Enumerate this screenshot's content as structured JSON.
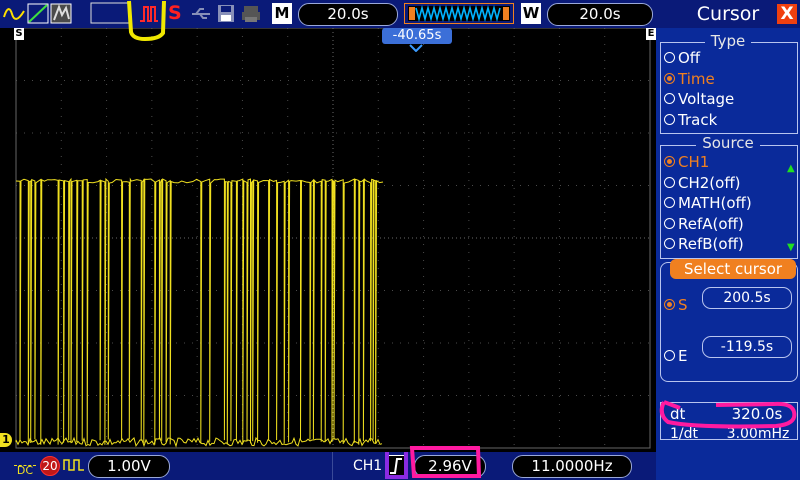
{
  "topbar": {
    "mode_glyph": "M",
    "timebase": "20.0s",
    "window_glyph": "W",
    "window_timebase": "20.0s",
    "stop_glyph": "S"
  },
  "screen": {
    "trigger_time_readout": "-40.65s",
    "left_marker": "S",
    "right_marker": "E",
    "ch1_marker": "1"
  },
  "panel": {
    "title": "Cursor",
    "close_glyph": "X",
    "type": {
      "title": "Type",
      "options": [
        {
          "label": "Off",
          "selected": false
        },
        {
          "label": "Time",
          "selected": true
        },
        {
          "label": "Voltage",
          "selected": false
        },
        {
          "label": "Track",
          "selected": false
        }
      ]
    },
    "source": {
      "title": "Source",
      "options": [
        {
          "label": "CH1",
          "selected": true
        },
        {
          "label": "CH2(off)",
          "selected": false
        },
        {
          "label": "MATH(off)",
          "selected": false
        },
        {
          "label": "RefA(off)",
          "selected": false
        },
        {
          "label": "RefB(off)",
          "selected": false
        }
      ],
      "scroll_up": "▲",
      "scroll_down": "▼"
    },
    "select": {
      "title": "Select cursor",
      "s_label": "S",
      "s_value": "200.5s",
      "e_label": "E",
      "e_value": "-119.5s"
    },
    "dt_label": "dt",
    "dt_value": "320.0s",
    "inv_dt_label": "1/dt",
    "inv_dt_value": "3.00mHz"
  },
  "bottombar": {
    "coupling": "DC",
    "bw_limit": "20",
    "volts_div": "1.00V",
    "trigger_channel": "CH1",
    "trigger_level": "2.96V",
    "frequency": "11.0000Hz"
  },
  "colors": {
    "trace": "#f0e020",
    "panel_bg": "#0a2a9a",
    "bar_bg": "#0a1a78",
    "highlight_selected": "#f08020",
    "annotation_yellow": "#f0e800",
    "annotation_magenta": "#ff1aa0",
    "annotation_purple": "#8a2be2"
  }
}
